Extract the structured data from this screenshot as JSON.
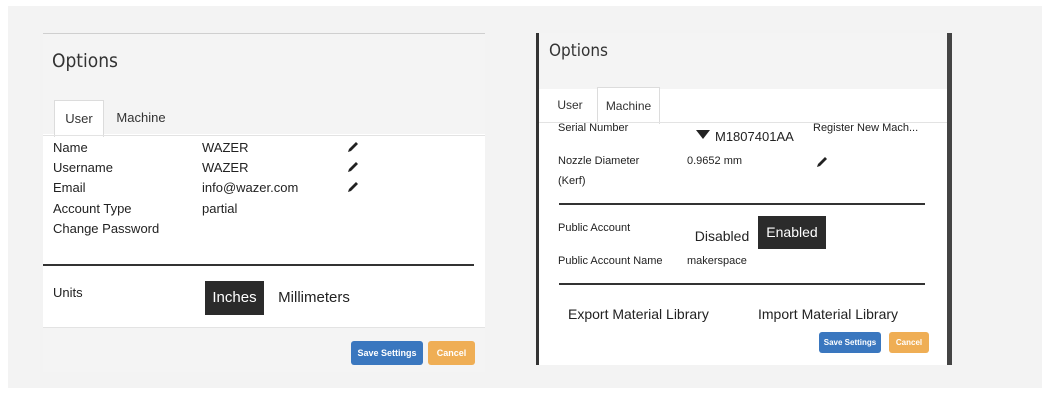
{
  "left_dialog": {
    "title": "Options",
    "tabs": [
      {
        "label": "User",
        "active": true
      },
      {
        "label": "Machine",
        "active": false
      }
    ],
    "fields": [
      {
        "label": "Name",
        "value": "WAZER",
        "editable": true
      },
      {
        "label": "Username",
        "value": "WAZER",
        "editable": true
      },
      {
        "label": "Email",
        "value": "info@wazer.com",
        "editable": true
      },
      {
        "label": "Account Type",
        "value": "partial",
        "editable": false
      },
      {
        "label": "Change Password",
        "value": "",
        "editable": false
      }
    ],
    "units": {
      "label": "Units",
      "options": [
        "Inches",
        "Millimeters"
      ],
      "selected": "Inches"
    },
    "save_label": "Save Settings",
    "cancel_label": "Cancel"
  },
  "right_dialog": {
    "title": "Options",
    "tabs": [
      {
        "label": "User",
        "active": false
      },
      {
        "label": "Machine",
        "active": true
      }
    ],
    "serial_label": "Serial Number",
    "serial_value": "M1807401AA",
    "register_label": "Register New Mach...",
    "nozzle_label_line1": "Nozzle Diameter",
    "nozzle_label_line2": "(Kerf)",
    "nozzle_value": "0.9652 mm",
    "public_account_label": "Public Account",
    "public_account_options": [
      "Disabled",
      "Enabled"
    ],
    "public_account_selected": "Enabled",
    "public_name_label": "Public Account Name",
    "public_name_value": "makerspace",
    "export_label": "Export Material Library",
    "import_label": "Import Material Library",
    "save_label": "Save Settings",
    "cancel_label": "Cancel"
  },
  "colors": {
    "save": "#3a77bf",
    "cancel": "#efae55",
    "selected_segment": "#2b2b2b"
  }
}
